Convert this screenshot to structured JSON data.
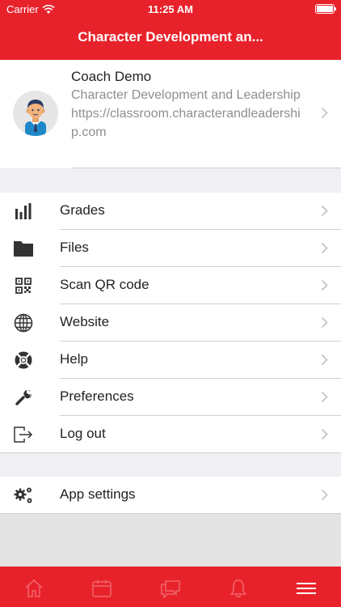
{
  "status": {
    "carrier": "Carrier",
    "time": "11:25 AM"
  },
  "header": {
    "title": "Character Development an..."
  },
  "profile": {
    "name": "Coach Demo",
    "org": "Character Development and Leadership",
    "url": "https://classroom.characterandleadership.com"
  },
  "menu": [
    {
      "label": "Grades",
      "icon": "bar-chart-icon"
    },
    {
      "label": "Files",
      "icon": "folder-icon"
    },
    {
      "label": "Scan QR code",
      "icon": "qr-code-icon"
    },
    {
      "label": "Website",
      "icon": "globe-icon"
    },
    {
      "label": "Help",
      "icon": "lifebuoy-icon"
    },
    {
      "label": "Preferences",
      "icon": "wrench-icon"
    },
    {
      "label": "Log out",
      "icon": "logout-icon"
    }
  ],
  "settings": [
    {
      "label": "App settings",
      "icon": "gears-icon"
    }
  ],
  "tabbar": {
    "items": [
      "home-icon",
      "calendar-icon",
      "messages-icon",
      "bell-icon",
      "menu-icon"
    ],
    "active": "menu-icon"
  },
  "colors": {
    "brand": "#e8222b",
    "icon": "#333333",
    "secondary_text": "#8e8e93"
  }
}
